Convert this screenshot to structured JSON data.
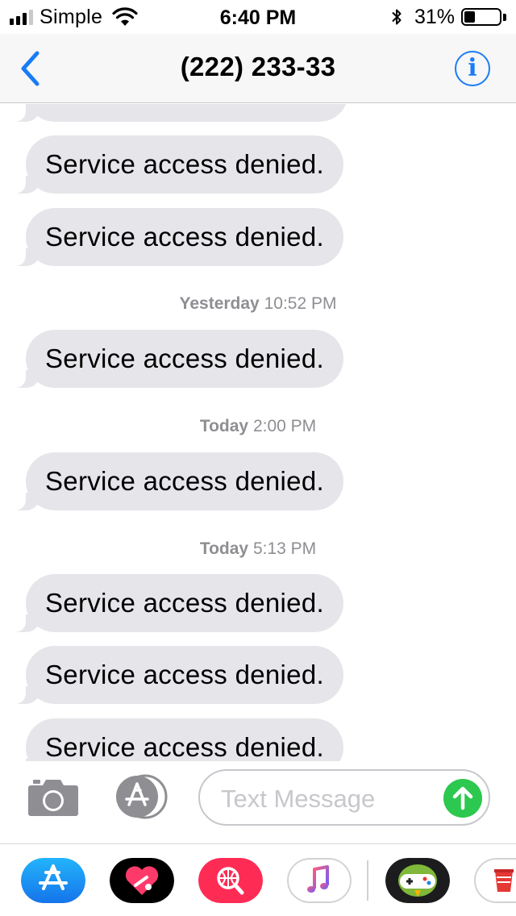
{
  "status_bar": {
    "carrier": "Simple",
    "time": "6:40 PM",
    "battery_percent": "31%",
    "battery_level": 0.31,
    "signal_bars_active": 3,
    "signal_bars_total": 4
  },
  "nav": {
    "title": "(222) 233-33",
    "info_glyph": "i",
    "accent_color": "#1a7cf5"
  },
  "messages": [
    {
      "type": "bubble",
      "text": ""
    },
    {
      "type": "bubble",
      "text": "Service access denied."
    },
    {
      "type": "bubble",
      "text": "Service access denied."
    },
    {
      "type": "timestamp",
      "day": "Yesterday",
      "time": "10:52 PM"
    },
    {
      "type": "bubble",
      "text": "Service access denied."
    },
    {
      "type": "timestamp",
      "day": "Today",
      "time": "2:00 PM"
    },
    {
      "type": "bubble",
      "text": "Service access denied."
    },
    {
      "type": "timestamp",
      "day": "Today",
      "time": "5:13 PM"
    },
    {
      "type": "bubble",
      "text": "Service access denied."
    },
    {
      "type": "bubble",
      "text": "Service access denied."
    },
    {
      "type": "bubble",
      "text": "Service access denied."
    }
  ],
  "input": {
    "placeholder": "Text Message",
    "send_color": "#2cc84f"
  },
  "app_drawer": [
    {
      "name": "app-store-icon"
    },
    {
      "name": "digital-touch-icon"
    },
    {
      "name": "images-search-icon"
    },
    {
      "name": "music-icon"
    },
    {
      "name": "game-pigeon-icon"
    },
    {
      "name": "cup-icon"
    }
  ]
}
